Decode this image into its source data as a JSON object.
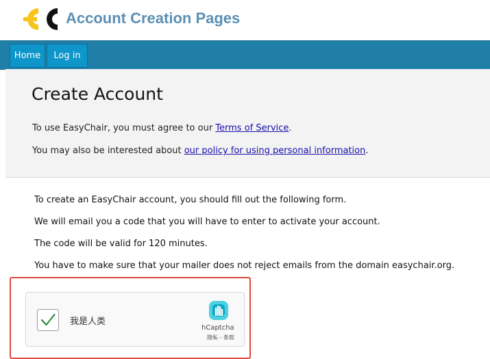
{
  "header": {
    "title": "Account Creation Pages",
    "logo_text": "EC",
    "logo_icon": "easychair-logo-icon",
    "logo_colors": {
      "primary": "#f7c41b",
      "secondary": "#111111"
    }
  },
  "nav": {
    "background": "#1f7fa6",
    "items": [
      {
        "label": "Home"
      },
      {
        "label": "Log in"
      }
    ]
  },
  "intro": {
    "title": "Create Account",
    "line1_prefix": "To use EasyChair, you must agree to our ",
    "line1_link": "Terms of Service",
    "line1_suffix": ".",
    "line2_prefix": "You may also be interested about ",
    "line2_link": "our policy for using personal information",
    "line2_suffix": "."
  },
  "body": {
    "lines": [
      "To create an EasyChair account, you should fill out the following form.",
      "We will email you a code that you will have to enter to activate your account.",
      "The code will be valid for 120 minutes.",
      "You have to make sure that your mailer does not reject emails from the domain easychair.org."
    ]
  },
  "captcha": {
    "label": "我是人类",
    "checked": true,
    "checkmark_icon": "checkmark-icon",
    "provider": "hCaptcha",
    "provider_icon": "hcaptcha-logo-icon",
    "links": "隐私 - 条款",
    "highlight_color": "#e0463c"
  }
}
